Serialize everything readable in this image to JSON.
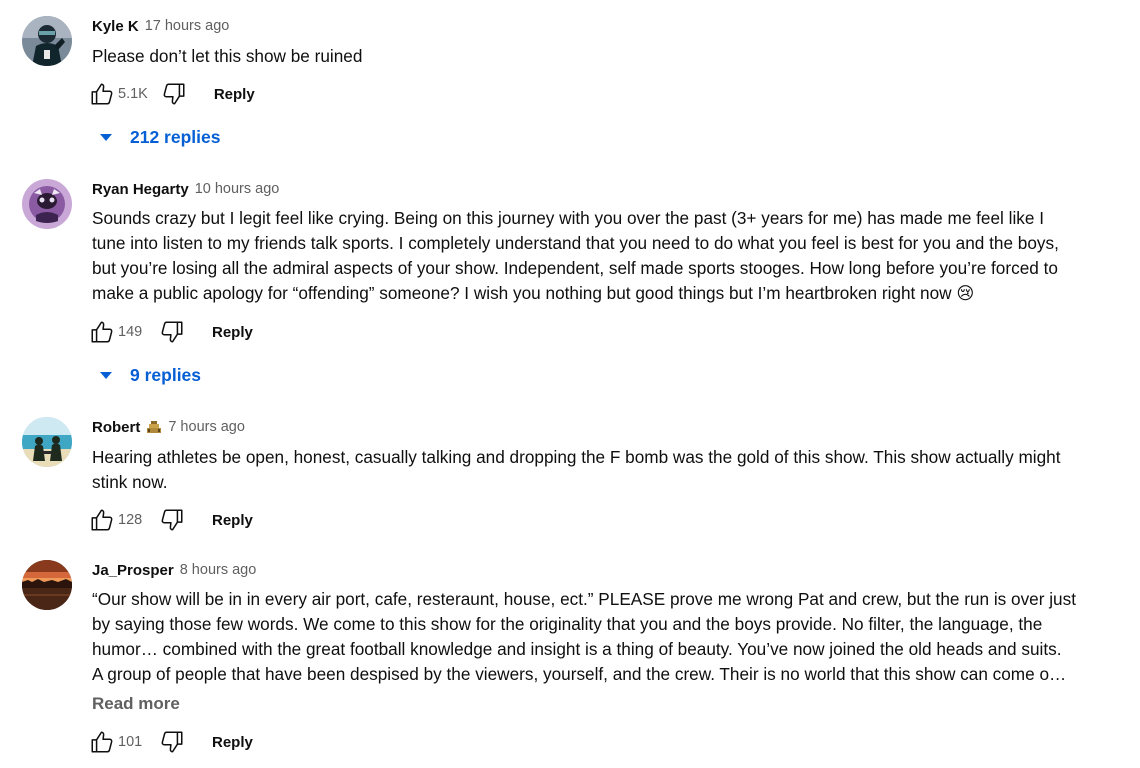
{
  "comments": [
    {
      "author": "Kyle K",
      "time": "17 hours ago",
      "text": [
        "Please don’t let this show be ruined"
      ],
      "likes": "5.1K",
      "reply_label": "Reply",
      "replies_label": "212 replies",
      "avatar_icon": "football-player-avatar"
    },
    {
      "author": "Ryan Hegarty",
      "time": "10 hours ago",
      "text": [
        "Sounds crazy but I legit feel like crying. Being on this journey with you over the past (3+ years for me) has made me feel like I",
        "tune into listen to my friends talk sports. I completely understand that you need to do what you feel is best for you and the boys,",
        "but you’re losing all the admiral aspects of your show. Independent, self made sports stooges. How long before you’re forced to",
        "make a public apology for “offending” someone? I wish you nothing but good things but I’m heartbroken right now 😢"
      ],
      "likes": "149",
      "reply_label": "Reply",
      "replies_label": "9 replies",
      "avatar_icon": "purple-character-avatar"
    },
    {
      "author": "Robert",
      "badge_icon": "member-badge-icon",
      "time": "7 hours ago",
      "text": [
        "Hearing athletes be open, honest, casually talking and dropping the F bomb was the gold of this show. This show actually might",
        "stink now."
      ],
      "likes": "128",
      "reply_label": "Reply",
      "avatar_icon": "beach-couple-avatar"
    },
    {
      "author": "Ja_Prosper",
      "time": "8 hours ago",
      "text": [
        "“Our show will be in in every air port, cafe, resteraunt, house, ect.” PLEASE prove me wrong Pat and crew, but the run is over just",
        "by saying those few words. We come to this show for the originality that you and the boys provide. No filter, the language, the",
        "humor… combined with the great football knowledge and insight is a thing of beauty. You’ve now joined the old heads and suits.",
        "A group of people that have been despised by the viewers, yourself, and the crew. Their is no world that this show can come o…"
      ],
      "read_more": "Read more",
      "likes": "101",
      "reply_label": "Reply",
      "avatar_icon": "sunset-avatar"
    }
  ],
  "colors": {
    "link_blue": "#065fd4",
    "secondary_text": "#606060",
    "primary_text": "#0f0f0f"
  }
}
